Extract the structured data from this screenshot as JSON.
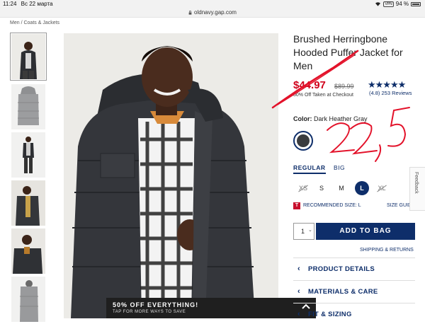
{
  "status": {
    "time": "11:24",
    "date": "Вс 22 марта",
    "vpn": "VPN",
    "battery": "94 %"
  },
  "browser": {
    "url": "oldnavy.gap.com"
  },
  "breadcrumb": {
    "part1": "Men",
    "sep": "/",
    "part2": "Coats & Jackets"
  },
  "product": {
    "title": "Brushed Herringbone Hooded Puffer Jacket for Men",
    "price": "$44.97",
    "old_price": "$89.99",
    "discount": "50% Off Taken at Checkout",
    "stars": "★★★★★",
    "reviews": "(4.8) 253 Reviews",
    "color_label": "Color:",
    "color_value": "Dark Heather Gray"
  },
  "fit": {
    "regular": "REGULAR",
    "big": "BIG"
  },
  "sizes": [
    {
      "label": "XS",
      "available": false
    },
    {
      "label": "S",
      "available": true
    },
    {
      "label": "M",
      "available": true
    },
    {
      "label": "L",
      "available": true,
      "selected": true
    },
    {
      "label": "XL",
      "available": false
    }
  ],
  "recommend": {
    "icon": "T",
    "text": "RECOMMENDED SIZE: L",
    "size_guide": "SIZE GUIDE"
  },
  "cart": {
    "qty": "1",
    "add_label": "ADD TO BAG",
    "shipping": "SHIPPING & RETURNS"
  },
  "accordion": [
    "PRODUCT DETAILS",
    "MATERIALS & CARE",
    "FIT & SIZING"
  ],
  "promo": {
    "title": "50% OFF EVERYTHING!",
    "subtitle": "TAP FOR MORE WAYS TO SAVE"
  },
  "feedback": "Feedback",
  "annotation": {
    "handwritten": "22,5",
    "color": "#e3122a"
  },
  "colors": {
    "navy": "#0e2e6a",
    "sale_red": "#d0021b",
    "promo_bg": "#1f1f1f"
  }
}
